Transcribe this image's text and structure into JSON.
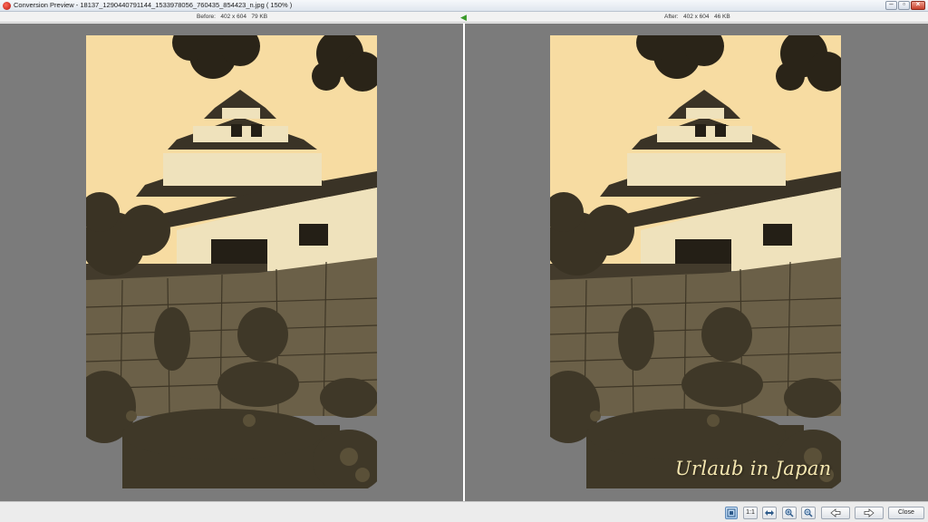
{
  "window": {
    "title": "Conversion Preview - 18137_1290440791144_1533978056_760435_854423_n.jpg  ( 150% )"
  },
  "preview": {
    "before_label": "Before:",
    "before_dims": "402 x 604",
    "before_size": "79 KB",
    "after_label": "After:",
    "after_dims": "402 x 604",
    "after_size": "46 KB",
    "after_overlay_text": "Urlaub in Japan"
  },
  "toolbar": {
    "fit_icon": "fit-window-icon",
    "actual_size_label": "1:1",
    "zoom_in_icon": "zoom-in-icon",
    "zoom_out_icon": "zoom-out-icon",
    "prev_icon": "arrow-left-icon",
    "next_icon": "arrow-right-icon",
    "close_label": "Close"
  },
  "colors": {
    "pane_bg": "#7b7b7b",
    "sepia_sky": "#f7dca2",
    "accent_green": "#3a9a2a"
  }
}
